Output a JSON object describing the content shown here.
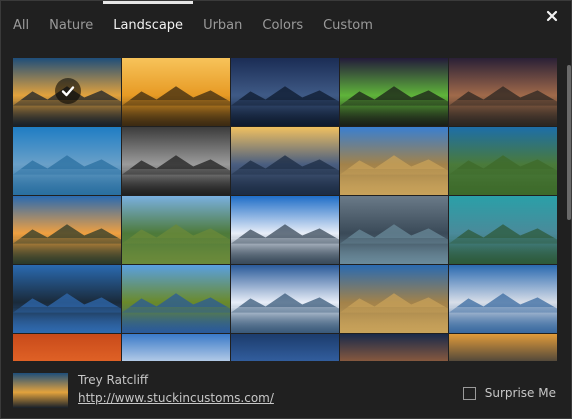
{
  "tabs": [
    "All",
    "Nature",
    "Landscape",
    "Urban",
    "Colors",
    "Custom"
  ],
  "active_tab": "Landscape",
  "close_icon": "close-icon",
  "thumbnails": [
    {
      "top": "#1e4e7a",
      "mid": "#e2a23d",
      "bottom": "#18202a",
      "selected": true
    },
    {
      "top": "#f7c35a",
      "mid": "#e79a24",
      "bottom": "#3b2a12",
      "selected": false
    },
    {
      "top": "#1b2d55",
      "mid": "#3f5a86",
      "bottom": "#0e1a2e",
      "selected": false
    },
    {
      "top": "#231b3a",
      "mid": "#5fb43a",
      "bottom": "#1a1f18",
      "selected": false
    },
    {
      "top": "#2a2036",
      "mid": "#a06a4a",
      "bottom": "#2b2622",
      "selected": false
    },
    {
      "top": "#1f7dc4",
      "mid": "#6aa0c8",
      "bottom": "#2a6fa0",
      "selected": false
    },
    {
      "top": "#3c3c3c",
      "mid": "#9b9b9b",
      "bottom": "#1f1f1f",
      "selected": false
    },
    {
      "top": "#f0c060",
      "mid": "#4a5e80",
      "bottom": "#1c2c44",
      "selected": false
    },
    {
      "top": "#3a7fd0",
      "mid": "#a2824a",
      "bottom": "#c8a25a",
      "selected": false
    },
    {
      "top": "#1d6ea8",
      "mid": "#4a7a3a",
      "bottom": "#3d6a2a",
      "selected": false
    },
    {
      "top": "#2a6ab0",
      "mid": "#f0a040",
      "bottom": "#2b3a2a",
      "selected": false
    },
    {
      "top": "#7ab0e0",
      "mid": "#4d7a3a",
      "bottom": "#6b8a3a",
      "selected": false
    },
    {
      "top": "#1f6ec8",
      "mid": "#e8eef8",
      "bottom": "#394a5a",
      "selected": false
    },
    {
      "top": "#6a7a88",
      "mid": "#3a4a58",
      "bottom": "#6a8a9a",
      "selected": false
    },
    {
      "top": "#2aa0a8",
      "mid": "#4a8a9a",
      "bottom": "#2d5a3a",
      "selected": false
    },
    {
      "top": "#2a6ab0",
      "mid": "#1a2a3a",
      "bottom": "#2f6ab0",
      "selected": false
    },
    {
      "top": "#5aa0e0",
      "mid": "#6a8a2a",
      "bottom": "#2a5a9a",
      "selected": false
    },
    {
      "top": "#2a5a9a",
      "mid": "#e8eef8",
      "bottom": "#3a5a7a",
      "selected": false
    },
    {
      "top": "#2a6ab0",
      "mid": "#a2824a",
      "bottom": "#c8a25a",
      "selected": false
    },
    {
      "top": "#2a6ab0",
      "mid": "#d8dee8",
      "bottom": "#3a6aa0",
      "selected": false
    },
    {
      "top": "#c84a1a",
      "mid": "#e86a2a",
      "bottom": "#a83a12",
      "selected": false
    },
    {
      "top": "#3a7ac8",
      "mid": "#dfe8f2",
      "bottom": "#2a5a9a",
      "selected": false
    },
    {
      "top": "#1c3c6c",
      "mid": "#3a6ab0",
      "bottom": "#2a4a7a",
      "selected": false
    },
    {
      "top": "#1a2a4a",
      "mid": "#b06a3a",
      "bottom": "#2a3a4a",
      "selected": false
    },
    {
      "top": "#e09a3a",
      "mid": "#1f2a3a",
      "bottom": "#c87a2a",
      "selected": false
    }
  ],
  "footer": {
    "author": "Trey Ratcliff",
    "link": "http://www.stuckincustoms.com/",
    "surprise_label": "Surprise Me",
    "surprise_checked": false
  }
}
